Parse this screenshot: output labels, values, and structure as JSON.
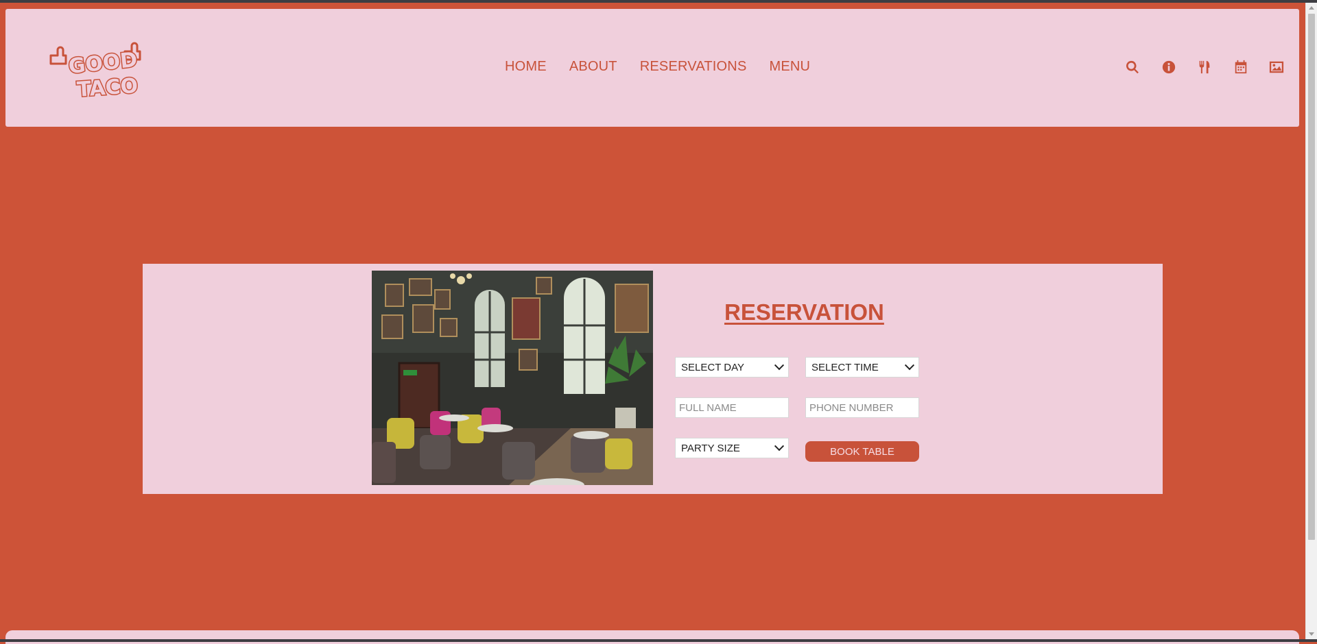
{
  "brand": {
    "logo_line1": "GOOD",
    "logo_line2": "TACO",
    "accent": "#c8523a",
    "background": "#cd5338",
    "panel": "#f0cfdc"
  },
  "nav": {
    "items": [
      {
        "label": "HOME"
      },
      {
        "label": "ABOUT"
      },
      {
        "label": "RESERVATIONS"
      },
      {
        "label": "MENU"
      }
    ]
  },
  "header_icons": [
    "search-icon",
    "info-icon",
    "utensils-icon",
    "calendar-icon",
    "image-icon"
  ],
  "reservation": {
    "title": "RESERVATION",
    "day_select": "SELECT DAY",
    "time_select": "SELECT TIME",
    "name_placeholder": "FULL NAME",
    "phone_placeholder": "PHONE NUMBER",
    "party_select": "PARTY SIZE",
    "book_label": "BOOK TABLE"
  }
}
